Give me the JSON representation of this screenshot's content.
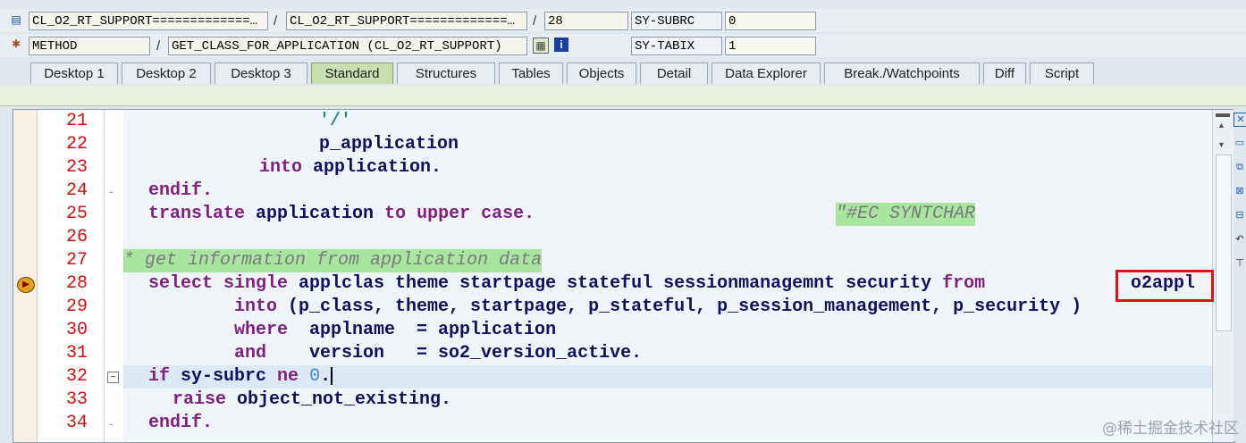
{
  "header": {
    "row1": {
      "program": "CL_O2_RT_SUPPORT=============…",
      "include": "CL_O2_RT_SUPPORT=============…",
      "line": "28",
      "sysfield1_name": "SY-SUBRC",
      "sysfield1_value": "0"
    },
    "row2": {
      "event_type": "METHOD",
      "event_name": "GET_CLASS_FOR_APPLICATION (CL_O2_RT_SUPPORT)",
      "sysfield2_name": "SY-TABIX",
      "sysfield2_value": "1"
    },
    "separator": "/"
  },
  "tabs": [
    {
      "label": "Desktop 1"
    },
    {
      "label": "Desktop 2"
    },
    {
      "label": "Desktop 3"
    },
    {
      "label": "Standard",
      "active": true
    },
    {
      "label": "Structures"
    },
    {
      "label": "Tables"
    },
    {
      "label": "Objects"
    },
    {
      "label": "Detail"
    },
    {
      "label": "Data Explorer"
    },
    {
      "label": "Break./Watchpoints"
    },
    {
      "label": "Diff"
    },
    {
      "label": "Script"
    }
  ],
  "code": {
    "lines": [
      {
        "num": "21"
      },
      {
        "num": "22"
      },
      {
        "num": "23"
      },
      {
        "num": "24"
      },
      {
        "num": "25"
      },
      {
        "num": "26"
      },
      {
        "num": "27"
      },
      {
        "num": "28"
      },
      {
        "num": "29"
      },
      {
        "num": "30"
      },
      {
        "num": "31"
      },
      {
        "num": "32"
      },
      {
        "num": "33"
      },
      {
        "num": "34"
      }
    ],
    "text": {
      "l21": "'/'",
      "l22": "p_application",
      "l23_kw": "into",
      "l23_rest": " application.",
      "l24": "endif.",
      "l25_a": "translate",
      "l25_b": " application ",
      "l25_c": "to upper case.",
      "l25_pragma": "\"#EC SYNTCHAR",
      "l27": "* get information from application data",
      "l28_a": "select single",
      "l28_b": " applclas theme startpage stateful sessionmanagemnt security ",
      "l28_c": "from",
      "l28_d": "o2appl",
      "l29_kw": "into",
      "l29_rest": " (p_class, theme, startpage, p_stateful, p_session_management, p_security )",
      "l30_kw": "where",
      "l30_rest": "  applname  = application",
      "l31_kw": "and",
      "l31_rest": "    version   = so2_version_active.",
      "l32_a": "if",
      "l32_b": " sy-subrc ",
      "l32_c": "ne",
      "l32_d": "0",
      "l32_e": ".",
      "l33_a": "raise",
      "l33_b": " object_not_existing.",
      "l34": "endif."
    }
  },
  "watermark": "@稀土掘金技术社区",
  "colors": {
    "line_number": "#d01010",
    "keyword": "#802080",
    "identifier": "#101060",
    "comment_bg": "#a8e6a0",
    "highlight_box": "#e01010",
    "active_tab": "#c9dfb0"
  }
}
